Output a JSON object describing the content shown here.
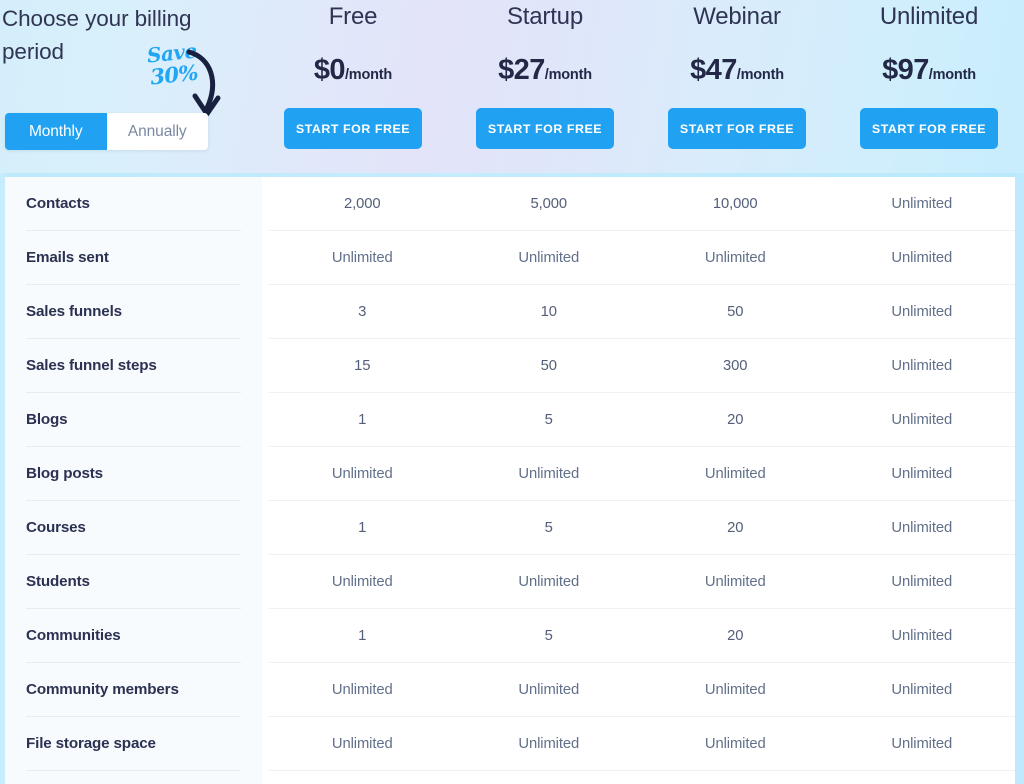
{
  "header": {
    "intro_title": "Choose your billing period",
    "save_badge_line1": "Save",
    "save_badge_line2": "30%",
    "toggle": {
      "monthly_label": "Monthly",
      "annually_label": "Annually",
      "selected": "Monthly"
    },
    "accent_color": "#21a1f1",
    "text_color": "#2f3453"
  },
  "plans": [
    {
      "name": "Free",
      "price": "$0",
      "period": "/month",
      "cta": "START FOR FREE"
    },
    {
      "name": "Startup",
      "price": "$27",
      "period": "/month",
      "cta": "START FOR FREE"
    },
    {
      "name": "Webinar",
      "price": "$47",
      "period": "/month",
      "cta": "START FOR FREE"
    },
    {
      "name": "Unlimited",
      "price": "$97",
      "period": "/month",
      "cta": "START FOR FREE"
    }
  ],
  "comparison_table": {
    "columns": [
      "Free",
      "Startup",
      "Webinar",
      "Unlimited"
    ],
    "rows": [
      {
        "feature": "Contacts",
        "values": [
          "2,000",
          "5,000",
          "10,000",
          "Unlimited"
        ]
      },
      {
        "feature": "Emails sent",
        "values": [
          "Unlimited",
          "Unlimited",
          "Unlimited",
          "Unlimited"
        ]
      },
      {
        "feature": "Sales funnels",
        "values": [
          "3",
          "10",
          "50",
          "Unlimited"
        ]
      },
      {
        "feature": "Sales funnel steps",
        "values": [
          "15",
          "50",
          "300",
          "Unlimited"
        ]
      },
      {
        "feature": "Blogs",
        "values": [
          "1",
          "5",
          "20",
          "Unlimited"
        ]
      },
      {
        "feature": "Blog posts",
        "values": [
          "Unlimited",
          "Unlimited",
          "Unlimited",
          "Unlimited"
        ]
      },
      {
        "feature": "Courses",
        "values": [
          "1",
          "5",
          "20",
          "Unlimited"
        ]
      },
      {
        "feature": "Students",
        "values": [
          "Unlimited",
          "Unlimited",
          "Unlimited",
          "Unlimited"
        ]
      },
      {
        "feature": "Communities",
        "values": [
          "1",
          "5",
          "20",
          "Unlimited"
        ]
      },
      {
        "feature": "Community members",
        "values": [
          "Unlimited",
          "Unlimited",
          "Unlimited",
          "Unlimited"
        ]
      },
      {
        "feature": "File storage space",
        "values": [
          "Unlimited",
          "Unlimited",
          "Unlimited",
          "Unlimited"
        ]
      }
    ]
  }
}
